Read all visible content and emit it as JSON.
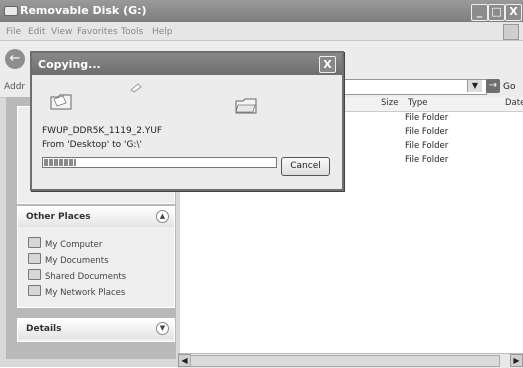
{
  "window": {
    "title": "Removable Disk (G:)",
    "buttons": {
      "minimize": "_",
      "maximize": "□",
      "close": "X"
    }
  },
  "menu": [
    "File",
    "Edit",
    "View",
    "Favorites",
    "Tools",
    "Help"
  ],
  "address": {
    "label": "Addr",
    "go_label": "Go"
  },
  "left_pane": {
    "other_places": {
      "title": "Other Places",
      "items": [
        "My Computer",
        "My Documents",
        "Shared Documents",
        "My Network Places"
      ]
    },
    "details": {
      "title": "Details"
    }
  },
  "file_list": {
    "columns": {
      "size": "Size",
      "type": "Type",
      "date": "Date"
    },
    "rows": [
      {
        "type": "File Folder"
      },
      {
        "type": "File Folder"
      },
      {
        "type": "File Folder"
      },
      {
        "type": "File Folder"
      }
    ]
  },
  "dialog": {
    "title": "Copying...",
    "file_name": "FWUP_DDR5K_1119_2.YUF",
    "from_to": "From 'Desktop' to 'G:\\'",
    "progress": 0.14,
    "cancel_label": "Cancel",
    "close_label": "X"
  }
}
